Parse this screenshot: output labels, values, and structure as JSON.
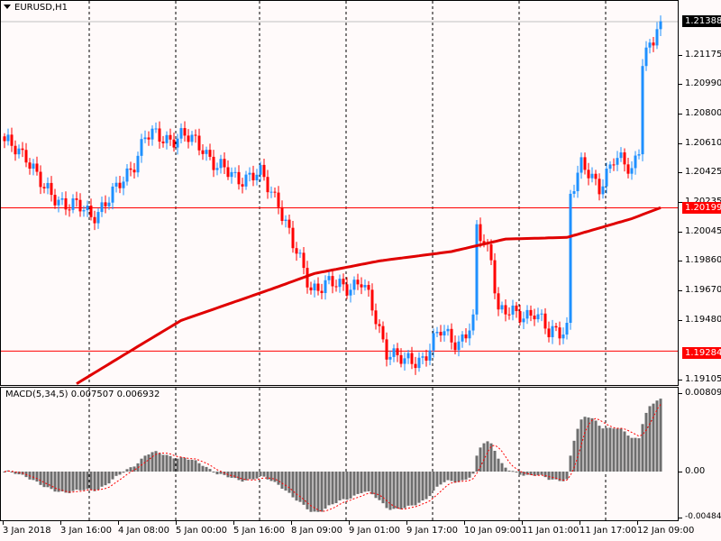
{
  "header": {
    "symbol_timeframe": "EURUSD,H1"
  },
  "price_axis": {
    "labels": [
      "1.21175",
      "1.20990",
      "1.20800",
      "1.20610",
      "1.20425",
      "1.20235",
      "1.20045",
      "1.19860",
      "1.19670",
      "1.19480",
      "1.19105"
    ],
    "values": [
      1.21175,
      1.2099,
      1.208,
      1.2061,
      1.20425,
      1.20235,
      1.20045,
      1.1986,
      1.1967,
      1.1948,
      1.19105
    ],
    "current_price": "1.21388",
    "level_1": "1.20199",
    "level_2": "1.19284"
  },
  "macd": {
    "label": "MACD(5,34,5) 0.007507 0.006932",
    "axis_max": "0.008095",
    "axis_zero": "0.00",
    "axis_min": "-0.004844"
  },
  "time_axis": [
    "3 Jan 2018",
    "3 Jan 16:00",
    "4 Jan 08:00",
    "5 Jan 00:00",
    "5 Jan 16:00",
    "8 Jan 09:00",
    "9 Jan 01:00",
    "9 Jan 17:00",
    "10 Jan 09:00",
    "11 Jan 01:00",
    "11 Jan 17:00",
    "12 Jan 09:00"
  ],
  "colors": {
    "up": "#1e90ff",
    "down": "#ff0000",
    "ma": "#e00000",
    "hist": "#6e6e6e",
    "level": "#ff0000",
    "bg": "#fffafa"
  },
  "chart_data": {
    "type": "candlestick",
    "bars": 183,
    "close_keypoints": [
      [
        0,
        1.206
      ],
      [
        6,
        1.2055
      ],
      [
        11,
        1.203
      ],
      [
        16,
        1.2025
      ],
      [
        24,
        1.2015
      ],
      [
        31,
        1.203
      ],
      [
        36,
        1.205
      ],
      [
        39,
        1.2065
      ],
      [
        44,
        1.2065
      ],
      [
        49,
        1.2065
      ],
      [
        55,
        1.206
      ],
      [
        59,
        1.2045
      ],
      [
        64,
        1.204
      ],
      [
        71,
        1.204
      ],
      [
        76,
        1.2025
      ],
      [
        80,
        1.1995
      ],
      [
        85,
        1.197
      ],
      [
        91,
        1.197
      ],
      [
        99,
        1.1972
      ],
      [
        102,
        1.1955
      ],
      [
        106,
        1.193
      ],
      [
        111,
        1.192
      ],
      [
        116,
        1.1925
      ],
      [
        121,
        1.194
      ],
      [
        126,
        1.1935
      ],
      [
        130,
        1.1945
      ],
      [
        131,
        1.2005
      ],
      [
        135,
        1.199
      ],
      [
        137,
        1.1955
      ],
      [
        142,
        1.195
      ],
      [
        147,
        1.1955
      ],
      [
        151,
        1.1938
      ],
      [
        156,
        1.1945
      ],
      [
        157,
        1.203
      ],
      [
        160,
        1.2045
      ],
      [
        165,
        1.2035
      ],
      [
        169,
        1.205
      ],
      [
        174,
        1.2045
      ],
      [
        176,
        1.206
      ],
      [
        177,
        1.2115
      ],
      [
        180,
        1.2125
      ],
      [
        182,
        1.2139
      ]
    ],
    "ma_keypoints": [
      [
        16,
        1.1902
      ],
      [
        36,
        1.193
      ],
      [
        49,
        1.1948
      ],
      [
        74,
        1.1968
      ],
      [
        86,
        1.1978
      ],
      [
        104,
        1.1986
      ],
      [
        124,
        1.1992
      ],
      [
        139,
        1.2
      ],
      [
        156,
        1.2001
      ],
      [
        174,
        1.2013
      ],
      [
        182,
        1.202
      ]
    ],
    "horizontal_levels": [
      1.21388,
      1.20199,
      1.19284
    ],
    "y_range": [
      1.191,
      1.2145
    ]
  }
}
